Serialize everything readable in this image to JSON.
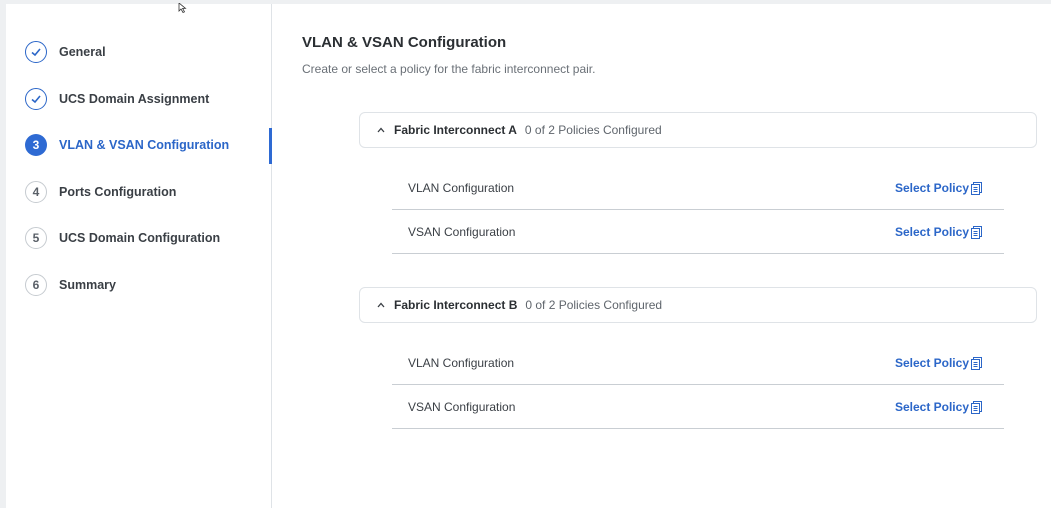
{
  "wizard": {
    "steps": [
      {
        "marker": "✓",
        "state": "done",
        "label": "General"
      },
      {
        "marker": "✓",
        "state": "done",
        "label": "UCS Domain Assignment"
      },
      {
        "marker": "3",
        "state": "active",
        "label": "VLAN & VSAN Configuration"
      },
      {
        "marker": "4",
        "state": "todo",
        "label": "Ports Configuration"
      },
      {
        "marker": "5",
        "state": "todo",
        "label": "UCS Domain Configuration"
      },
      {
        "marker": "6",
        "state": "todo",
        "label": "Summary"
      }
    ]
  },
  "main": {
    "title": "VLAN & VSAN Configuration",
    "subtitle": "Create or select a policy for the fabric interconnect pair.",
    "fabric_a": {
      "title": "Fabric Interconnect A",
      "count": "0 of 2 Policies Configured",
      "policies": [
        {
          "name": "VLAN Configuration",
          "action": "Select Policy"
        },
        {
          "name": "VSAN Configuration",
          "action": "Select Policy"
        }
      ]
    },
    "fabric_b": {
      "title": "Fabric Interconnect B",
      "count": "0 of 2 Policies Configured",
      "policies": [
        {
          "name": "VLAN Configuration",
          "action": "Select Policy"
        },
        {
          "name": "VSAN Configuration",
          "action": "Select Policy"
        }
      ]
    }
  },
  "colors": {
    "accent": "#2e6ad3",
    "link": "#2b66c8",
    "border": "#dfe3e7"
  },
  "icons": {
    "collapse": "chevron-up-icon",
    "policy_doc": "document-list-icon",
    "step_done": "check-icon"
  }
}
